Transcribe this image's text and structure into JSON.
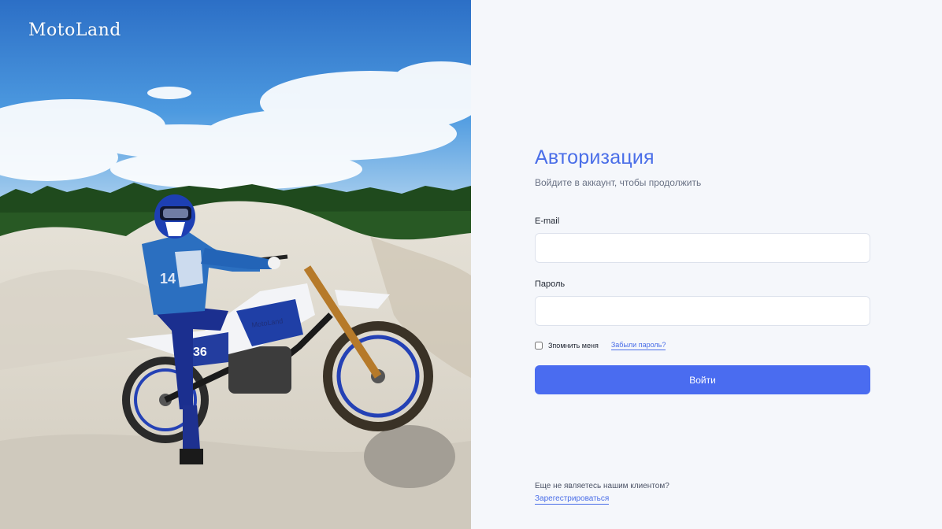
{
  "brand": {
    "name": "MotoLand"
  },
  "hero": {
    "bike_logo": "MotoLand",
    "bike_number": "36",
    "jersey_number": "14"
  },
  "auth": {
    "title": "Авторизация",
    "subtitle": "Войдите в аккаунт, чтобы продолжить",
    "email_label": "E-mail",
    "email_value": "",
    "email_placeholder": "",
    "password_label": "Пароль",
    "password_value": "",
    "password_placeholder": "",
    "remember_label": "Зпомнить меня",
    "remember_checked": false,
    "forgot_label": "Забыли пароль?",
    "submit_label": "Войти"
  },
  "signup": {
    "prompt": "Еще не являетесь нашим клиентом?",
    "link_label": "Зарегестрироваться"
  },
  "colors": {
    "accent": "#4a6cf0",
    "title": "#4a6ee8",
    "panel_bg": "#f5f7fb",
    "input_border": "#dde2ec"
  }
}
